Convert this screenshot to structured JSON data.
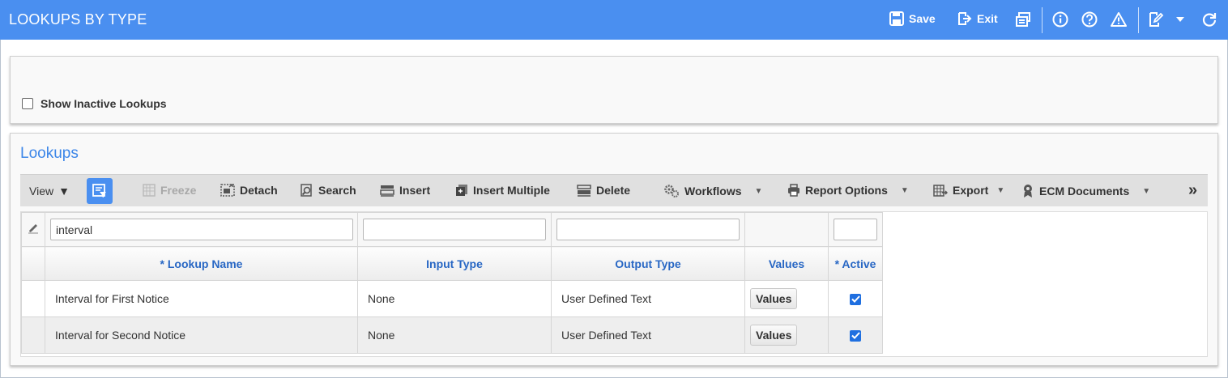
{
  "app": {
    "title": "LOOKUPS BY TYPE",
    "save_label": "Save",
    "exit_label": "Exit"
  },
  "criteria": {
    "show_inactive_label": "Show Inactive Lookups",
    "show_inactive_checked": false
  },
  "section": {
    "title": "Lookups"
  },
  "toolbar": {
    "view_label": "View",
    "freeze_label": "Freeze",
    "detach_label": "Detach",
    "search_label": "Search",
    "insert_label": "Insert",
    "insert_multiple_label": "Insert Multiple",
    "delete_label": "Delete",
    "workflows_label": "Workflows",
    "report_options_label": "Report Options",
    "export_label": "Export",
    "ecm_documents_label": "ECM Documents",
    "more_label": "»"
  },
  "grid": {
    "filters": {
      "lookup_name": "interval",
      "input_type": "",
      "output_type": "",
      "active": ""
    },
    "headers": {
      "lookup_name": "* Lookup Name",
      "input_type": "Input Type",
      "output_type": "Output Type",
      "values": "Values",
      "active": "* Active"
    },
    "rows": [
      {
        "lookup_name": "Interval for First Notice",
        "input_type": "None",
        "output_type": "User Defined Text",
        "values_label": "Values",
        "active": true
      },
      {
        "lookup_name": "Interval for Second Notice",
        "input_type": "None",
        "output_type": "User Defined Text",
        "values_label": "Values",
        "active": true
      }
    ]
  },
  "colors": {
    "titlebar": "#4a8ff0",
    "accent": "#3c86e8",
    "header_text": "#2867c4",
    "checkbox": "#1f6fe0"
  }
}
